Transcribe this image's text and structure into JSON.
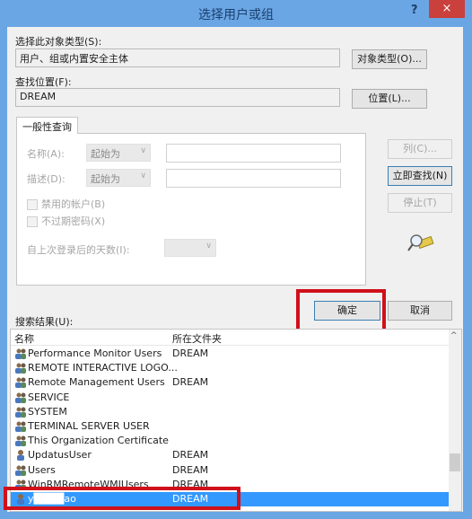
{
  "window": {
    "title": "选择用户或组",
    "help_label": "?",
    "close_label": "×"
  },
  "object_type": {
    "label": "选择此对象类型(S):",
    "value": "用户、组或内置安全主体",
    "button": "对象类型(O)..."
  },
  "location": {
    "label": "查找位置(F):",
    "value": "DREAM",
    "button": "位置(L)..."
  },
  "query": {
    "tab_label": "一般性查询",
    "name_label": "名称(A):",
    "name_mode": "起始为",
    "name_value": "",
    "desc_label": "描述(D):",
    "desc_mode": "起始为",
    "desc_value": "",
    "disabled_accounts_label": "禁用的帐户(B)",
    "non_expiring_label": "不过期密码(X)",
    "days_label": "自上次登录后的天数(I):",
    "days_value": ""
  },
  "side_buttons": {
    "columns": "列(C)...",
    "find_now": "立即查找(N)",
    "stop": "停止(T)"
  },
  "actions": {
    "ok": "确定",
    "cancel": "取消"
  },
  "results": {
    "label": "搜索结果(U):",
    "columns": [
      "名称",
      "所在文件夹"
    ],
    "rows": [
      {
        "name": "Performance Monitor Users",
        "folder": "DREAM",
        "type": "group"
      },
      {
        "name": "REMOTE INTERACTIVE LOGO...",
        "folder": "",
        "type": "group"
      },
      {
        "name": "Remote Management Users",
        "folder": "DREAM",
        "type": "group"
      },
      {
        "name": "SERVICE",
        "folder": "",
        "type": "group"
      },
      {
        "name": "SYSTEM",
        "folder": "",
        "type": "group"
      },
      {
        "name": "TERMINAL SERVER USER",
        "folder": "",
        "type": "group"
      },
      {
        "name": "This Organization Certificate",
        "folder": "",
        "type": "group"
      },
      {
        "name": "UpdatusUser",
        "folder": "DREAM",
        "type": "user"
      },
      {
        "name": "Users",
        "folder": "DREAM",
        "type": "group"
      },
      {
        "name": "WinRMRemoteWMIUsers__",
        "folder": "DREAM",
        "type": "group"
      },
      {
        "name": "y████ao",
        "folder": "DREAM",
        "type": "user",
        "selected": true
      }
    ]
  }
}
